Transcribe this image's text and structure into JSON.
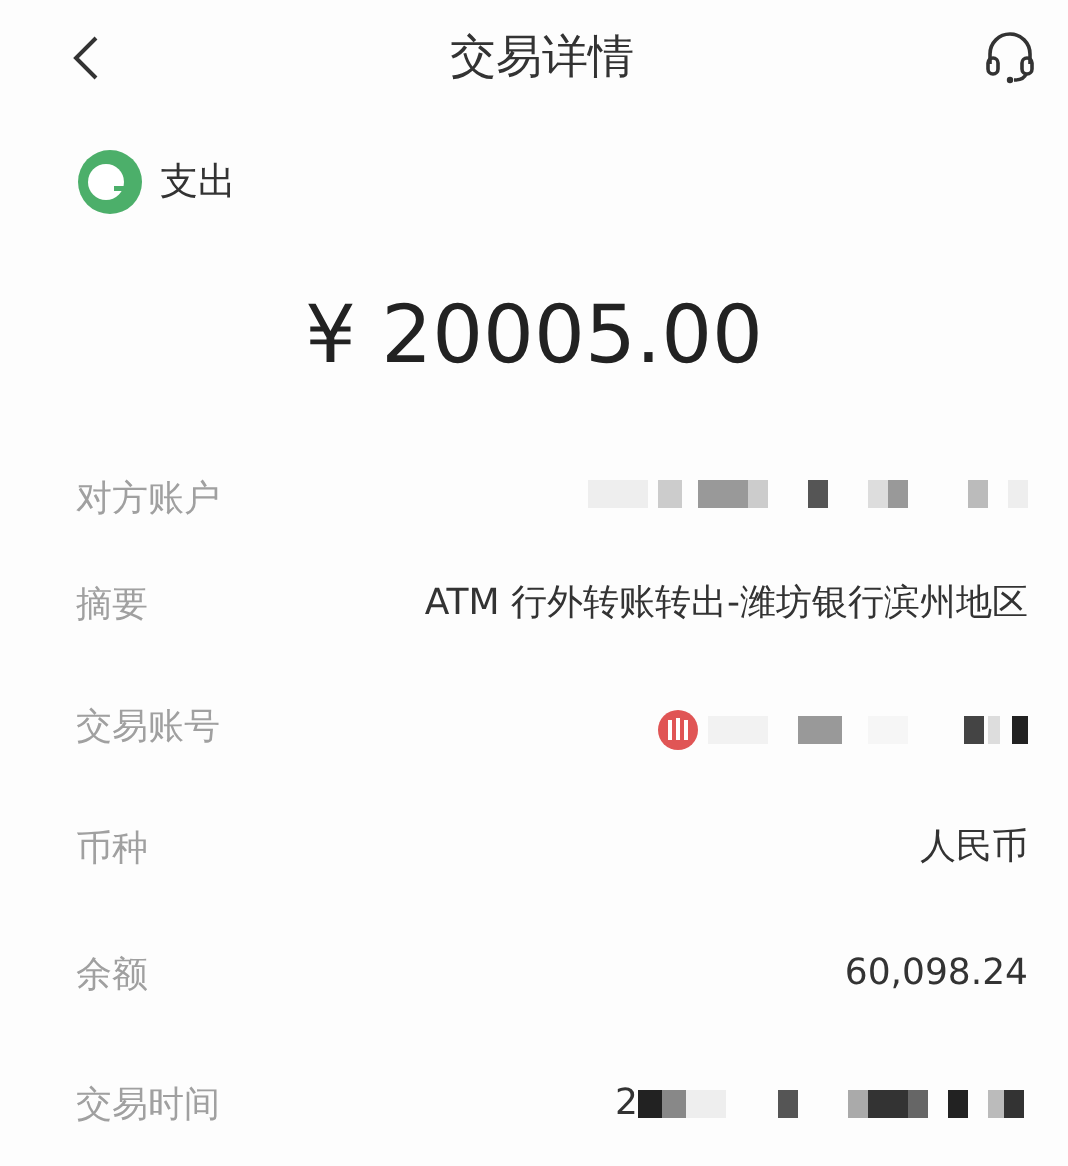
{
  "header": {
    "title": "交易详情"
  },
  "type": {
    "label": "支出"
  },
  "amount": "¥ 20005.00",
  "rows": [
    {
      "label": "对方账户",
      "kind": "masked"
    },
    {
      "label": "摘要",
      "kind": "text",
      "value": "ATM 行外转账转出-潍坊银行滨州地区"
    },
    {
      "label": "交易账号",
      "kind": "bank_masked"
    },
    {
      "label": "币种",
      "kind": "text",
      "value": "人民币"
    },
    {
      "label": "余额",
      "kind": "text",
      "value": "60,098.24"
    },
    {
      "label": "交易时间",
      "kind": "partial_masked",
      "value": "2"
    }
  ]
}
